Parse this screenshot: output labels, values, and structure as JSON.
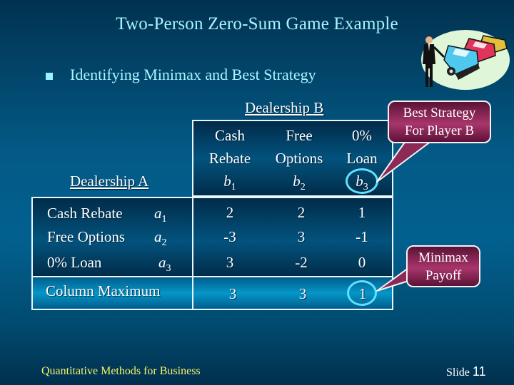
{
  "slide": {
    "title": "Two-Person Zero-Sum Game Example",
    "bullet": "Identifying Minimax and Best Strategy",
    "footer_left": "Quantitative Methods for Business",
    "footer_slide_label": "Slide",
    "footer_slide_number": "11",
    "clipart_icon": "car-dealer-salesman-icon"
  },
  "table": {
    "player_b_label": "Dealership B",
    "player_a_label": "Dealership A",
    "columns": [
      {
        "line1": "Cash",
        "line2": "Rebate",
        "symbol": "b",
        "index": "1"
      },
      {
        "line1": "Free",
        "line2": "Options",
        "symbol": "b",
        "index": "2"
      },
      {
        "line1": "0%",
        "line2": "Loan",
        "symbol": "b",
        "index": "3"
      }
    ],
    "rows": [
      {
        "label": "Cash Rebate",
        "symbol": "a",
        "index": "1",
        "values": [
          "2",
          "2",
          "1"
        ]
      },
      {
        "label": "Free Options",
        "symbol": "a",
        "index": "2",
        "values": [
          "-3",
          "3",
          "-1"
        ]
      },
      {
        "label": "0% Loan",
        "symbol": "a",
        "index": "3",
        "values": [
          "3",
          "-2",
          "0"
        ]
      }
    ],
    "column_max_label": "Column Maximum",
    "column_max_values": [
      "3",
      "3",
      "1"
    ]
  },
  "callouts": {
    "best_strategy_line1": "Best Strategy",
    "best_strategy_line2": "For Player B",
    "minimax_line1": "Minimax",
    "minimax_line2": "Payoff"
  },
  "colors": {
    "title": "#a9f4ff",
    "footer": "#f4f46a",
    "highlight_ring": "#5fe0ff",
    "callout": "#a8356b"
  }
}
